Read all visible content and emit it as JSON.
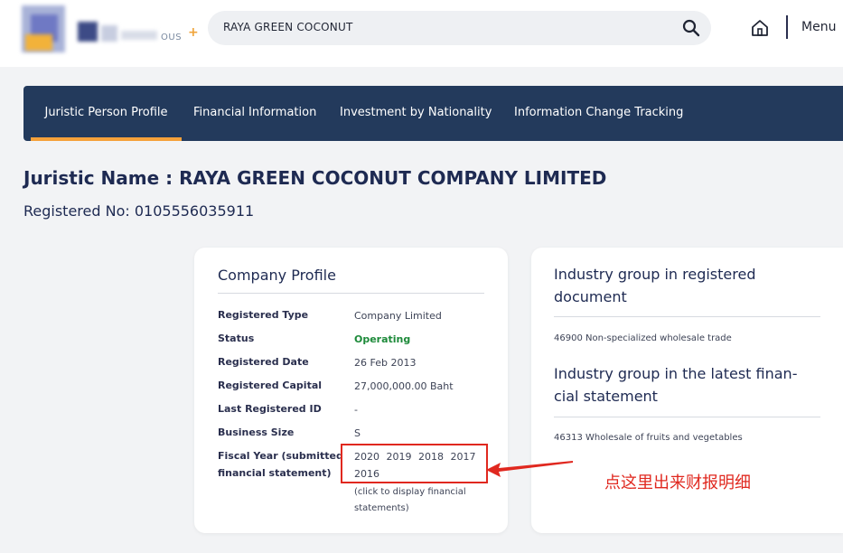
{
  "header": {
    "logo_text": "OUS",
    "search_value": "RAYA GREEN COCONUT",
    "menu_label": "Menu"
  },
  "tabs": [
    {
      "label": "Juristic Person Profile",
      "active": true
    },
    {
      "label": "Financial Information",
      "active": false
    },
    {
      "label": "Investment by Nationality",
      "active": false
    },
    {
      "label": "Information Change Tracking",
      "active": false
    }
  ],
  "juristic": {
    "name_line": "Juristic Name : RAYA GREEN COCONUT COMPANY LIMITED",
    "reg_line": "Registered No: 0105556035911"
  },
  "profile": {
    "title": "Company Profile",
    "rows": [
      {
        "label": "Registered Type",
        "value": "Company Limited"
      },
      {
        "label": "Status",
        "value": "Operating"
      },
      {
        "label": "Registered Date",
        "value": "26 Feb 2013"
      },
      {
        "label": "Registered Capital",
        "value": "27,000,000.00 Baht"
      },
      {
        "label": "Last Registered ID",
        "value": "-"
      },
      {
        "label": "Business Size",
        "value": "S"
      }
    ],
    "fiscal_label": "Fiscal Year (submitted financial statement)",
    "fiscal_years": "2020 2019 2018 2017 2016",
    "fiscal_hint": "(click to display financial statements)"
  },
  "industry": {
    "registered_title": "Industry group in registered document",
    "registered_value": "46900 Non-specialized wholesale trade",
    "latest_title": "Industry group in the latest finan- cial statement",
    "latest_value": "46313 Wholesale of fruits and vegetables"
  },
  "annotation": {
    "text": "点这里出来财报明细",
    "color": "#e0281f"
  },
  "colors": {
    "nav_bg": "#233a5c",
    "tab_underline": "#f5a13a",
    "status_green": "#1d8a3a",
    "heading": "#1e2a52"
  }
}
